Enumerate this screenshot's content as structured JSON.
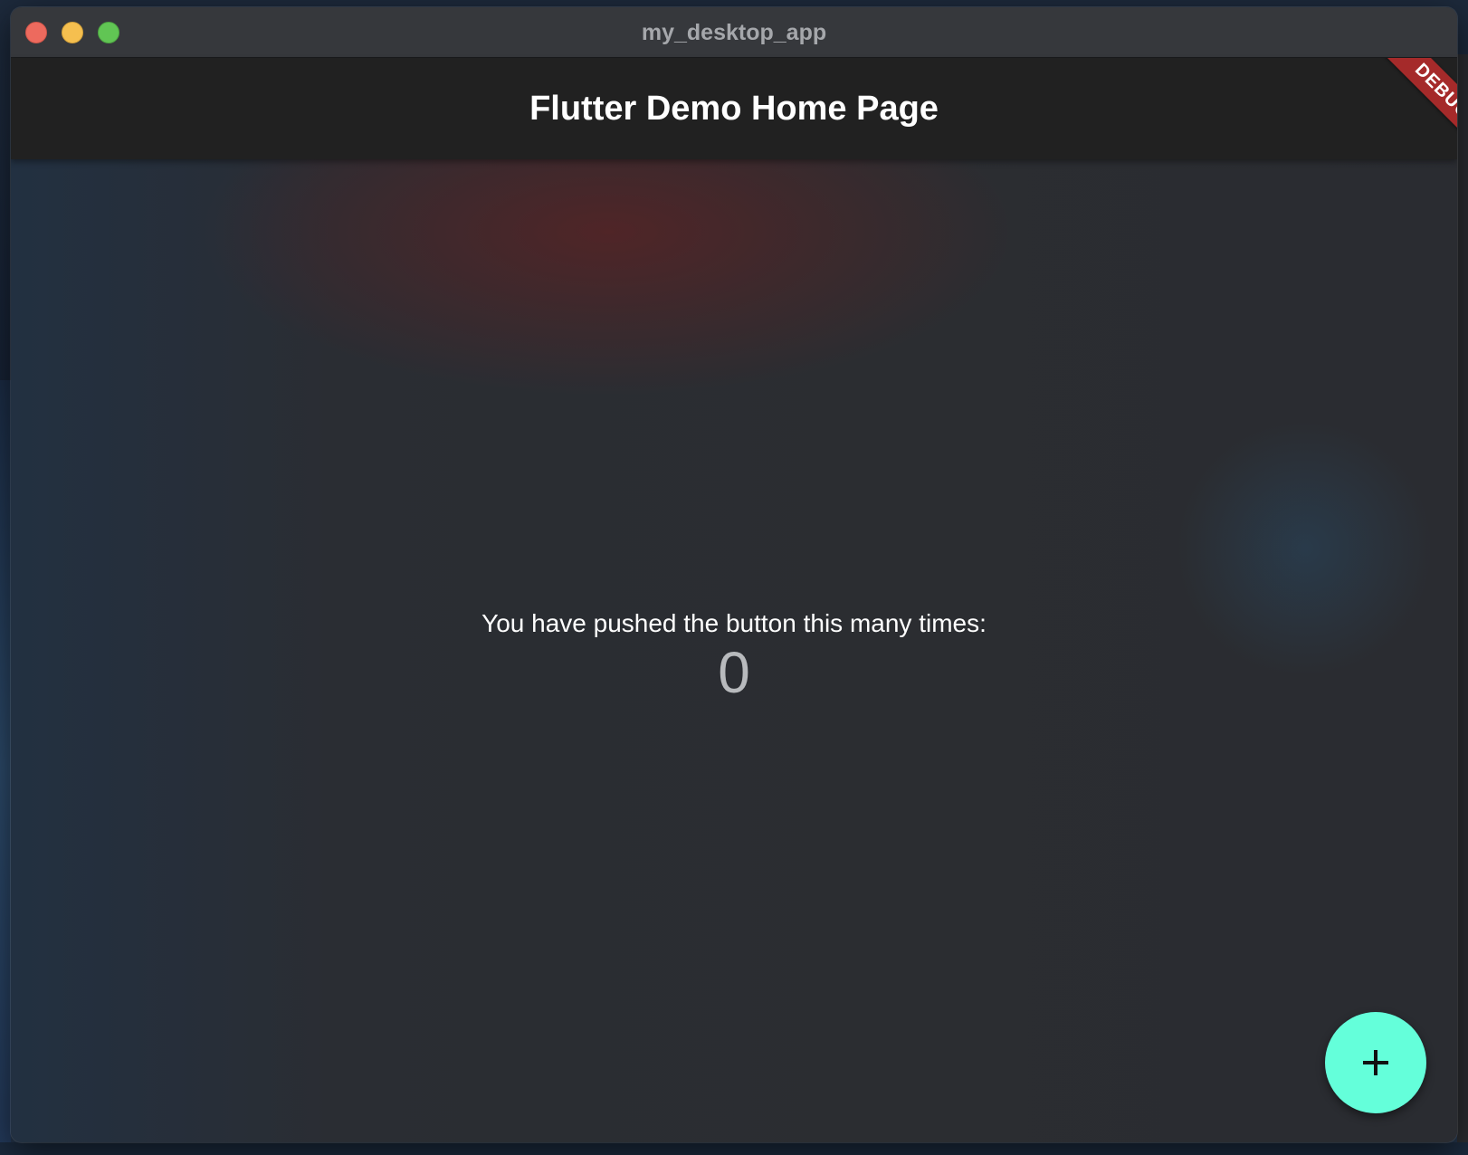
{
  "window": {
    "title": "my_desktop_app"
  },
  "appbar": {
    "title": "Flutter Demo Home Page"
  },
  "debug_banner": {
    "label": "DEBUG"
  },
  "counter": {
    "label": "You have pushed the button this many times:",
    "value": "0"
  },
  "fab": {
    "icon": "plus-icon",
    "color": "#64ffda"
  },
  "colors": {
    "appbar": "#212121",
    "background": "#2b2d31",
    "debug_ribbon": "#a52a2a",
    "close": "#ed6a5e",
    "minimize": "#f5bf4f",
    "maximize": "#61c554"
  }
}
